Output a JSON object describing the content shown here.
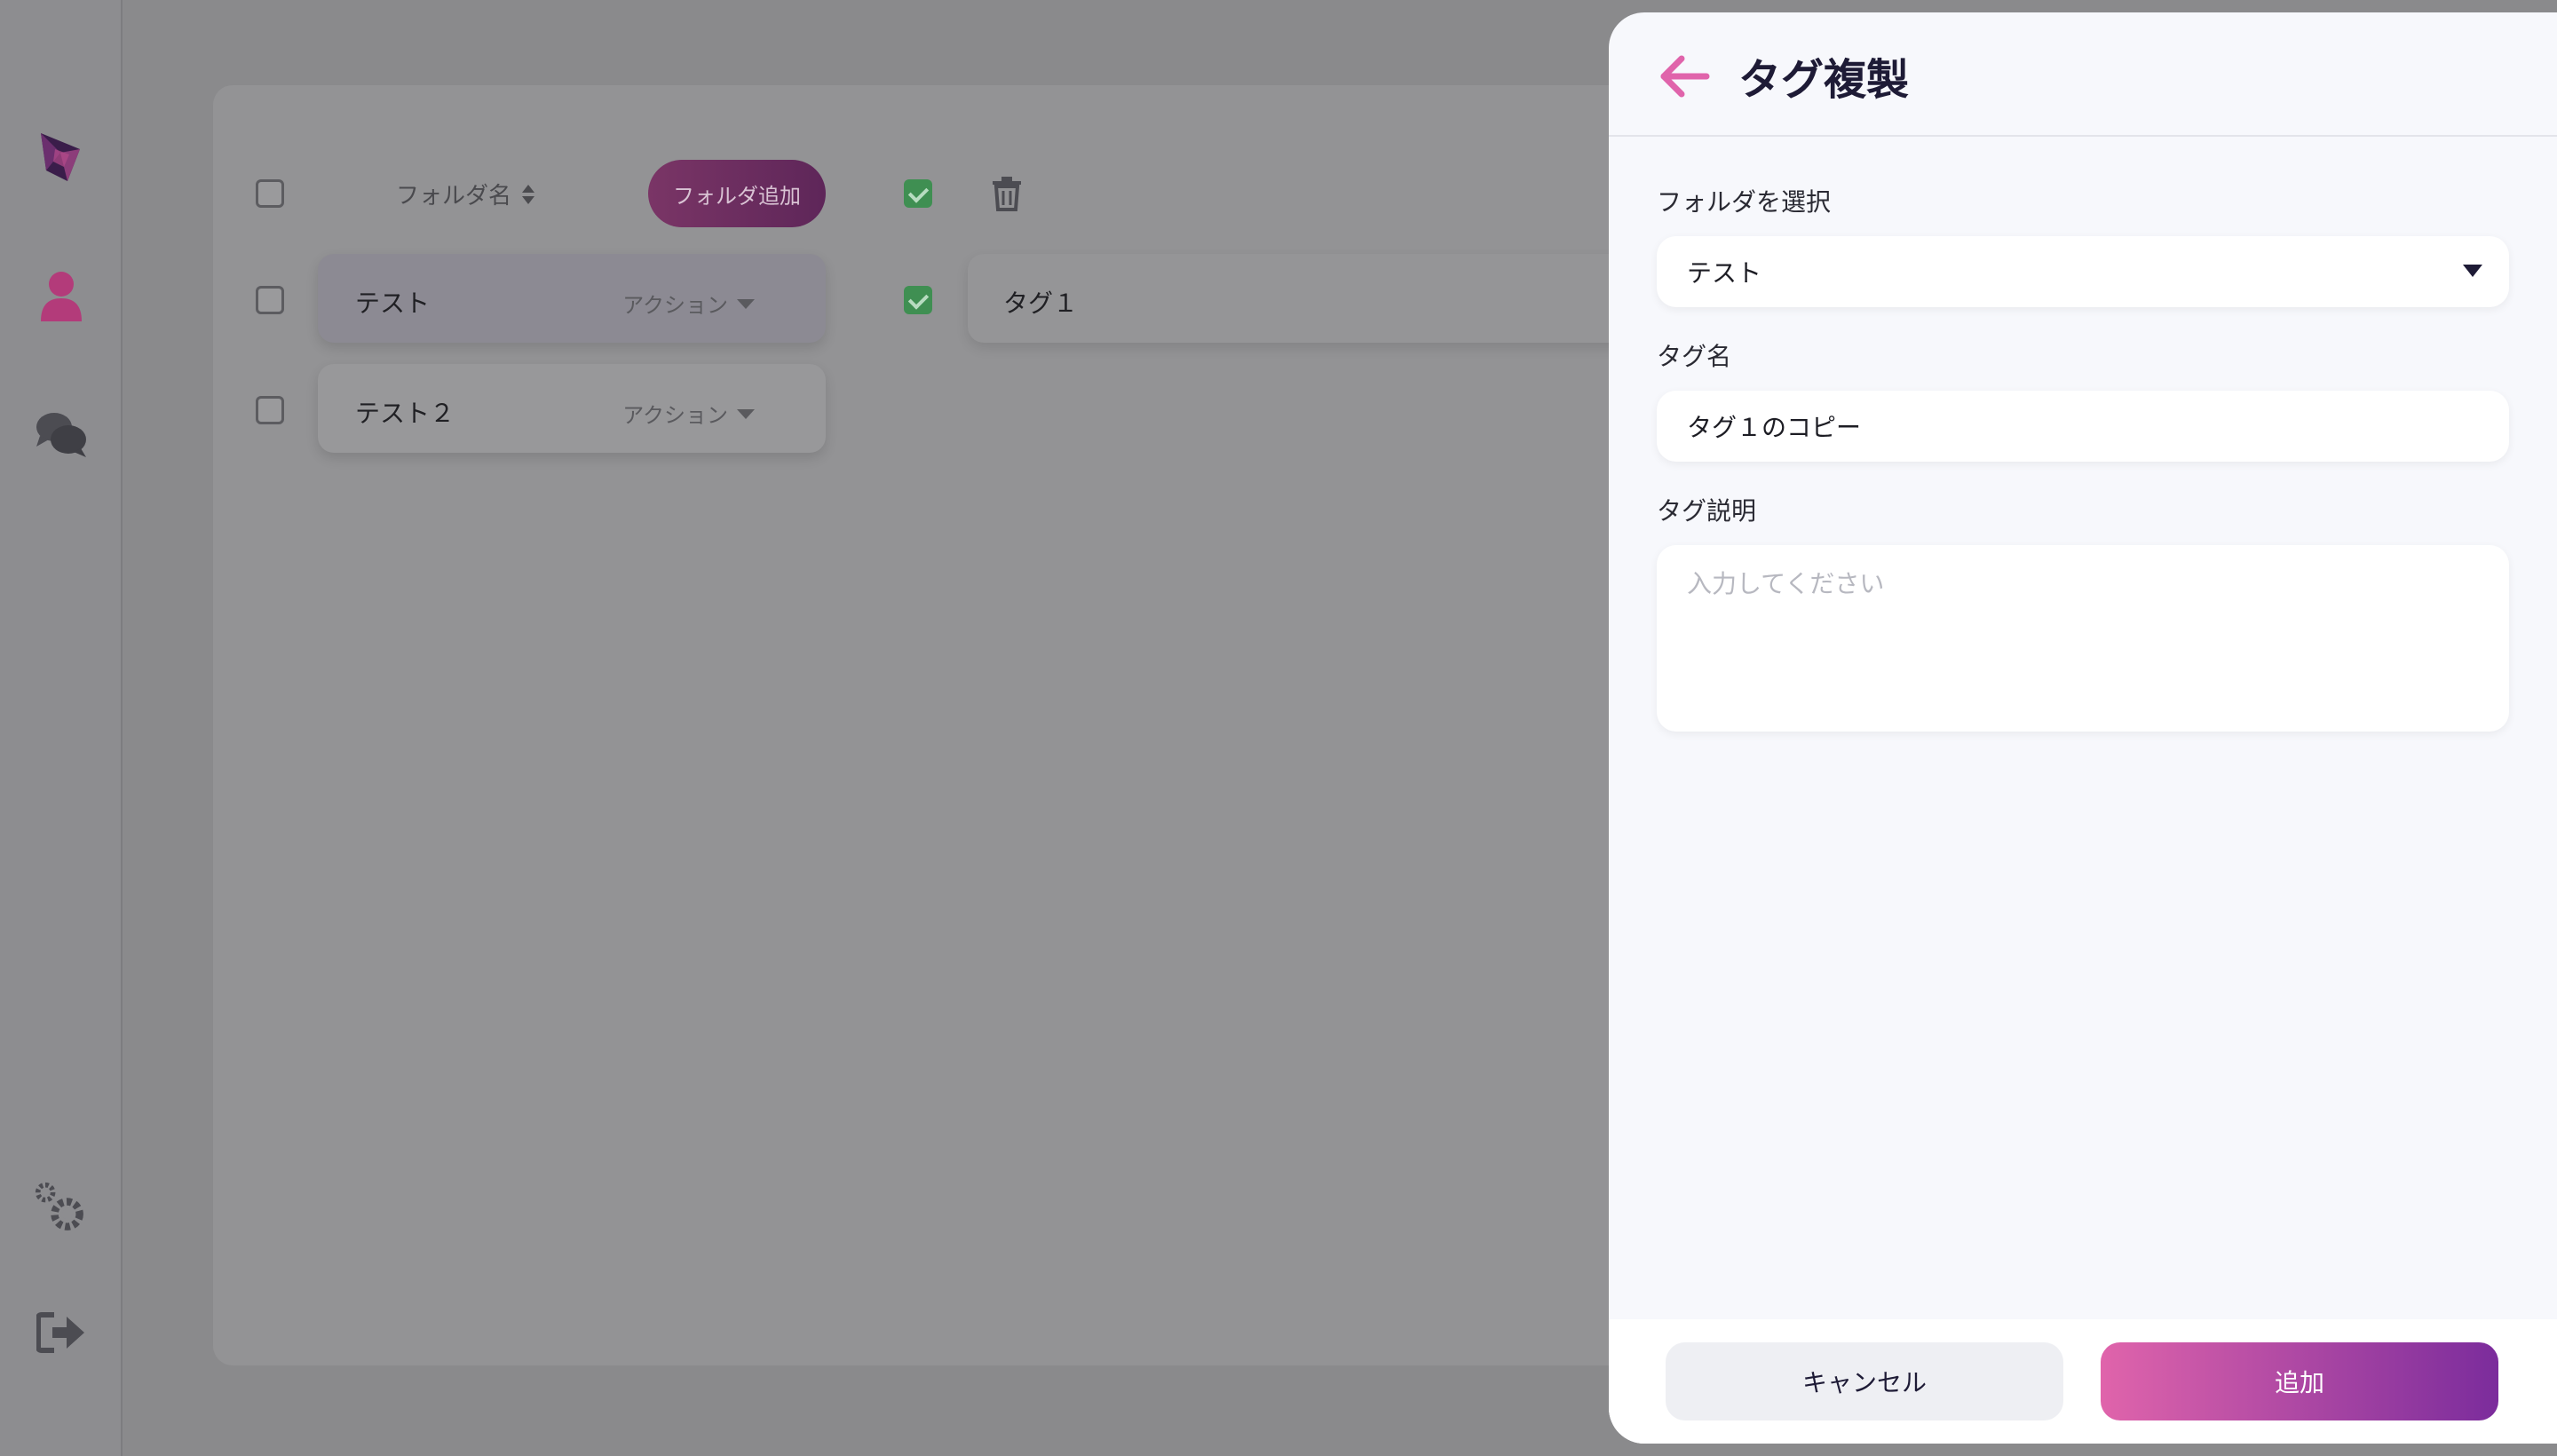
{
  "sidebar": {
    "icons": [
      "logo-icon",
      "user-icon",
      "chat-icon",
      "settings-icon",
      "logout-icon"
    ],
    "accent": "#b33b7a"
  },
  "folders": {
    "header_label": "フォルダ名",
    "add_button": "フォルダ追加",
    "rows": [
      {
        "name": "テスト",
        "action": "アクション",
        "selected": true
      },
      {
        "name": "テスト２",
        "action": "アクション",
        "selected": false
      }
    ]
  },
  "tags": {
    "rows": [
      {
        "name": "タグ１",
        "checked": true
      }
    ]
  },
  "drawer": {
    "title": "タグ複製",
    "folder_label": "フォルダを選択",
    "folder_value": "テスト",
    "tag_name_label": "タグ名",
    "tag_name_value": "タグ１のコピー",
    "description_label": "タグ説明",
    "description_placeholder": "入力してください",
    "cancel": "キャンセル",
    "submit": "追加"
  },
  "colors": {
    "accent_pink": "#e064ab",
    "accent_purple": "#7b2c9c",
    "title_dark": "#1e1b36"
  }
}
